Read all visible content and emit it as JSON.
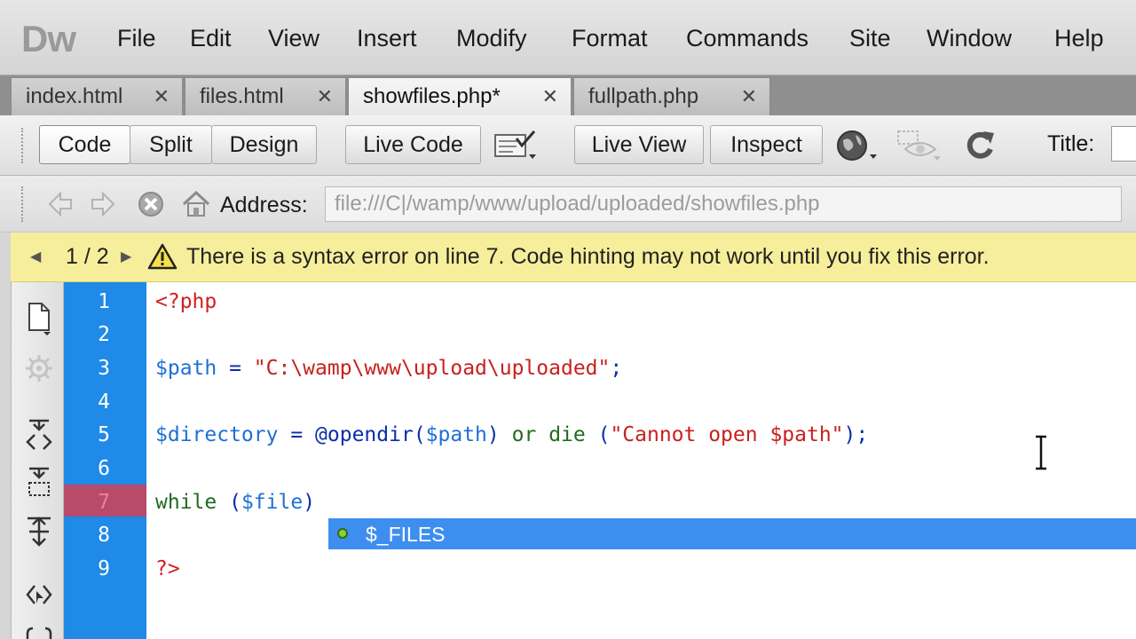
{
  "app": {
    "logo": "Dw"
  },
  "menu": [
    "File",
    "Edit",
    "View",
    "Insert",
    "Modify",
    "Format",
    "Commands",
    "Site",
    "Window",
    "Help"
  ],
  "tabs": [
    {
      "label": "index.html",
      "close": "✕"
    },
    {
      "label": "files.html",
      "close": "✕"
    },
    {
      "label": "showfiles.php*",
      "close": "✕"
    },
    {
      "label": "fullpath.php",
      "close": "✕"
    }
  ],
  "toolbar": {
    "code": "Code",
    "split": "Split",
    "design": "Design",
    "live_code": "Live Code",
    "live_view": "Live View",
    "inspect": "Inspect",
    "title_label": "Title:"
  },
  "address": {
    "label": "Address:",
    "value": "file:///C|/wamp/www/upload/uploaded/showfiles.php"
  },
  "error_bar": {
    "prev": "◀",
    "count": "1 / 2",
    "next": "▶",
    "message": "There is a syntax error on line 7.  Code hinting may not work until you fix this error."
  },
  "gutter": [
    "1",
    "2",
    "3",
    "4",
    "5",
    "6",
    "7",
    "8",
    "9"
  ],
  "code": {
    "l1": "<?php",
    "l3_var": "$path",
    "l3_eq": " = ",
    "l3_str": "\"C:\\wamp\\www\\upload\\uploaded\"",
    "l3_end": ";",
    "l5_var": "$directory",
    "l5_eq": " = ",
    "l5_fn": "@opendir",
    "l5_p1": "(",
    "l5_arg": "$path",
    "l5_p2": ") ",
    "l5_or": "or",
    "l5_sp": " ",
    "l5_die": "die",
    "l5_sp2": " (",
    "l5_str": "\"Cannot open $path\"",
    "l5_end": ");",
    "l7_kw": "while",
    "l7_p1": " (",
    "l7_var": "$file",
    "l7_p2": ")",
    "l9": "?>"
  },
  "hint": {
    "item": "$_FILES"
  },
  "icons": {
    "back": "back-arrow-icon",
    "forward": "forward-arrow-icon",
    "stop": "stop-icon",
    "home": "home-icon",
    "warning": "warning-icon",
    "globe": "globe-icon",
    "eye": "eye-icon",
    "refresh": "refresh-icon"
  },
  "colors": {
    "gutter": "#1f8ae8",
    "error_line": "#b84a6a",
    "error_bar": "#f7ee9c",
    "hint": "#3e8ef0"
  }
}
